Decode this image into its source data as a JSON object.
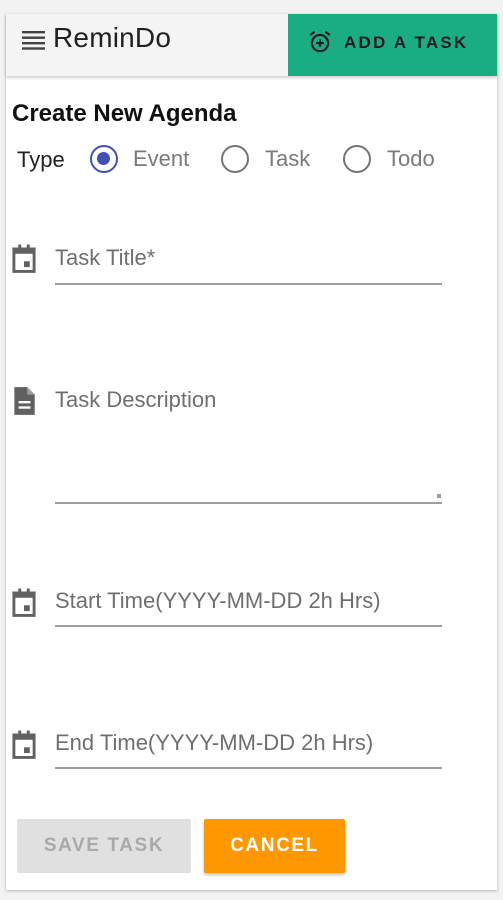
{
  "header": {
    "app_title": "ReminDo",
    "add_button_label": "ADD A TASK",
    "add_button_color": "#1aad84"
  },
  "form": {
    "heading": "Create New Agenda",
    "type": {
      "label": "Type",
      "options": [
        {
          "label": "Event",
          "selected": true
        },
        {
          "label": "Task",
          "selected": false
        },
        {
          "label": "Todo",
          "selected": false
        }
      ]
    },
    "fields": {
      "title": {
        "placeholder": "Task Title*",
        "icon": "calendar-icon"
      },
      "description": {
        "placeholder": "Task Description",
        "icon": "document-icon"
      },
      "start_time": {
        "placeholder": "Start Time(YYYY-MM-DD 2h Hrs)",
        "icon": "calendar-icon"
      },
      "end_time": {
        "placeholder": "End Time(YYYY-MM-DD 2h Hrs)",
        "icon": "calendar-icon"
      }
    },
    "buttons": {
      "save_label": "SAVE TASK",
      "save_disabled": true,
      "cancel_label": "CANCEL",
      "cancel_color": "#ff9800"
    }
  },
  "colors": {
    "accent": "#3f51b5"
  }
}
